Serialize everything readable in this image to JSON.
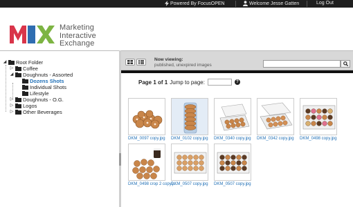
{
  "topbar": {
    "powered": "Powered By FocusOPEN",
    "welcome": "Welcome Jesse Gatten",
    "logout": "Log Out"
  },
  "logo": {
    "line1": "Marketing",
    "line2": "Interactive",
    "line3": "Exchange",
    "colors": {
      "m": "#d9354a",
      "i": "#2f6db1",
      "x": "#7db443"
    }
  },
  "tree": {
    "items": [
      {
        "label": "Root Folder",
        "toggle": "expanded"
      },
      {
        "label": "Coffee",
        "toggle": "collapsed"
      },
      {
        "label": "Doughnuts - Assorted",
        "toggle": "expanded"
      },
      {
        "label": "Dozens Shots",
        "active": true
      },
      {
        "label": "Individual Shots"
      },
      {
        "label": "Lifestyle"
      },
      {
        "label": "Doughnuts - O.G.",
        "toggle": "collapsed"
      },
      {
        "label": "Logos",
        "toggle": "collapsed"
      },
      {
        "label": "Other Beverages",
        "toggle": "collapsed"
      }
    ]
  },
  "toolbar": {
    "viewing_title": "Now viewing:",
    "viewing_sub": "published, unexpired images",
    "search_value": "",
    "grid_icon": "grid-view-icon",
    "list_icon": "list-view-icon",
    "search_icon": "magnifier-icon"
  },
  "pager": {
    "page_text": "Page 1 of 1",
    "jump_label": "Jump to page:",
    "jump_value": "",
    "help_icon": "help-icon"
  },
  "thumbnails": [
    {
      "caption": "DKM_0097 copy.jpg",
      "kind": "pile"
    },
    {
      "caption": "DKM_0102 copy.jpg",
      "kind": "stack"
    },
    {
      "caption": "DKM_0340 copy.jpg",
      "kind": "box-open"
    },
    {
      "caption": "DKM_0342 copy.jpg",
      "kind": "box-angle"
    },
    {
      "caption": "DKM_0498 copy.jpg",
      "kind": "box-mixed"
    },
    {
      "caption": "DKM_0498 crop 2 copy.j...",
      "kind": "box-coffee"
    },
    {
      "caption": "DKM_0507 copy.jpg",
      "kind": "box-glazed"
    },
    {
      "caption": "DKM_0507 copy.jpg",
      "kind": "box-choc"
    }
  ]
}
